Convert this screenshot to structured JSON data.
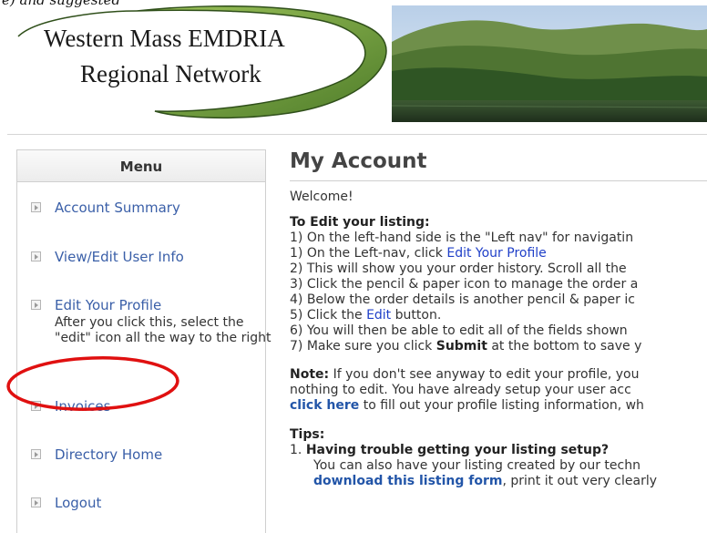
{
  "header": {
    "top_text": "e) and suggested",
    "org_name_line1": "Western Mass EMDRIA",
    "org_name_line2": "Regional Network"
  },
  "sidebar": {
    "title": "Menu",
    "items": [
      {
        "label": "Account Summary"
      },
      {
        "label": "View/Edit User Info"
      },
      {
        "label": "Edit Your Profile",
        "note": "After you click this, select the \"edit\" icon all the way to the right"
      },
      {
        "label": "Invoices"
      },
      {
        "label": "Directory Home"
      },
      {
        "label": "Logout"
      }
    ]
  },
  "main": {
    "title": "My Account",
    "welcome": "Welcome!",
    "edit_heading": "To Edit your listing:",
    "steps": {
      "s1a": "1) On the left-hand side is the \"Left nav\" for navigatin",
      "s1b_pre": "1) On the Left-nav, click ",
      "s1b_link": "Edit Your Profile",
      "s2": "2) This will show you your order history. Scroll all the",
      "s3": "3) Click the pencil & paper icon to manage the order a",
      "s4": "4) Below the order details is another pencil & paper ic",
      "s5_pre": "5) Click the ",
      "s5_link": "Edit",
      "s5_post": " button.",
      "s6": "6) You will then be able to edit all of the fields shown",
      "s7_pre": "7) Make sure you click ",
      "s7_bold": "Submit",
      "s7_post": " at the bottom to save y"
    },
    "note": {
      "label": "Note:",
      "line1": " If you don't see anyway to edit your profile, you",
      "line2": "nothing to edit. You have already setup your user acc",
      "link": "click here",
      "line3_post": " to fill out your profile listing information, wh"
    },
    "tips": {
      "heading": "Tips:",
      "item1_num": "1.",
      "item1_title": "Having trouble getting your listing setup?",
      "item1_text": "You can also have your listing created by our techn",
      "item1_link": "download this listing form",
      "item1_post": ", print it out very clearly"
    }
  },
  "colors": {
    "link": "#1f3fc8",
    "menu_link": "#3a5fa8",
    "annotation_circle": "#e01010",
    "logo_swoosh": "#7aa83a"
  }
}
